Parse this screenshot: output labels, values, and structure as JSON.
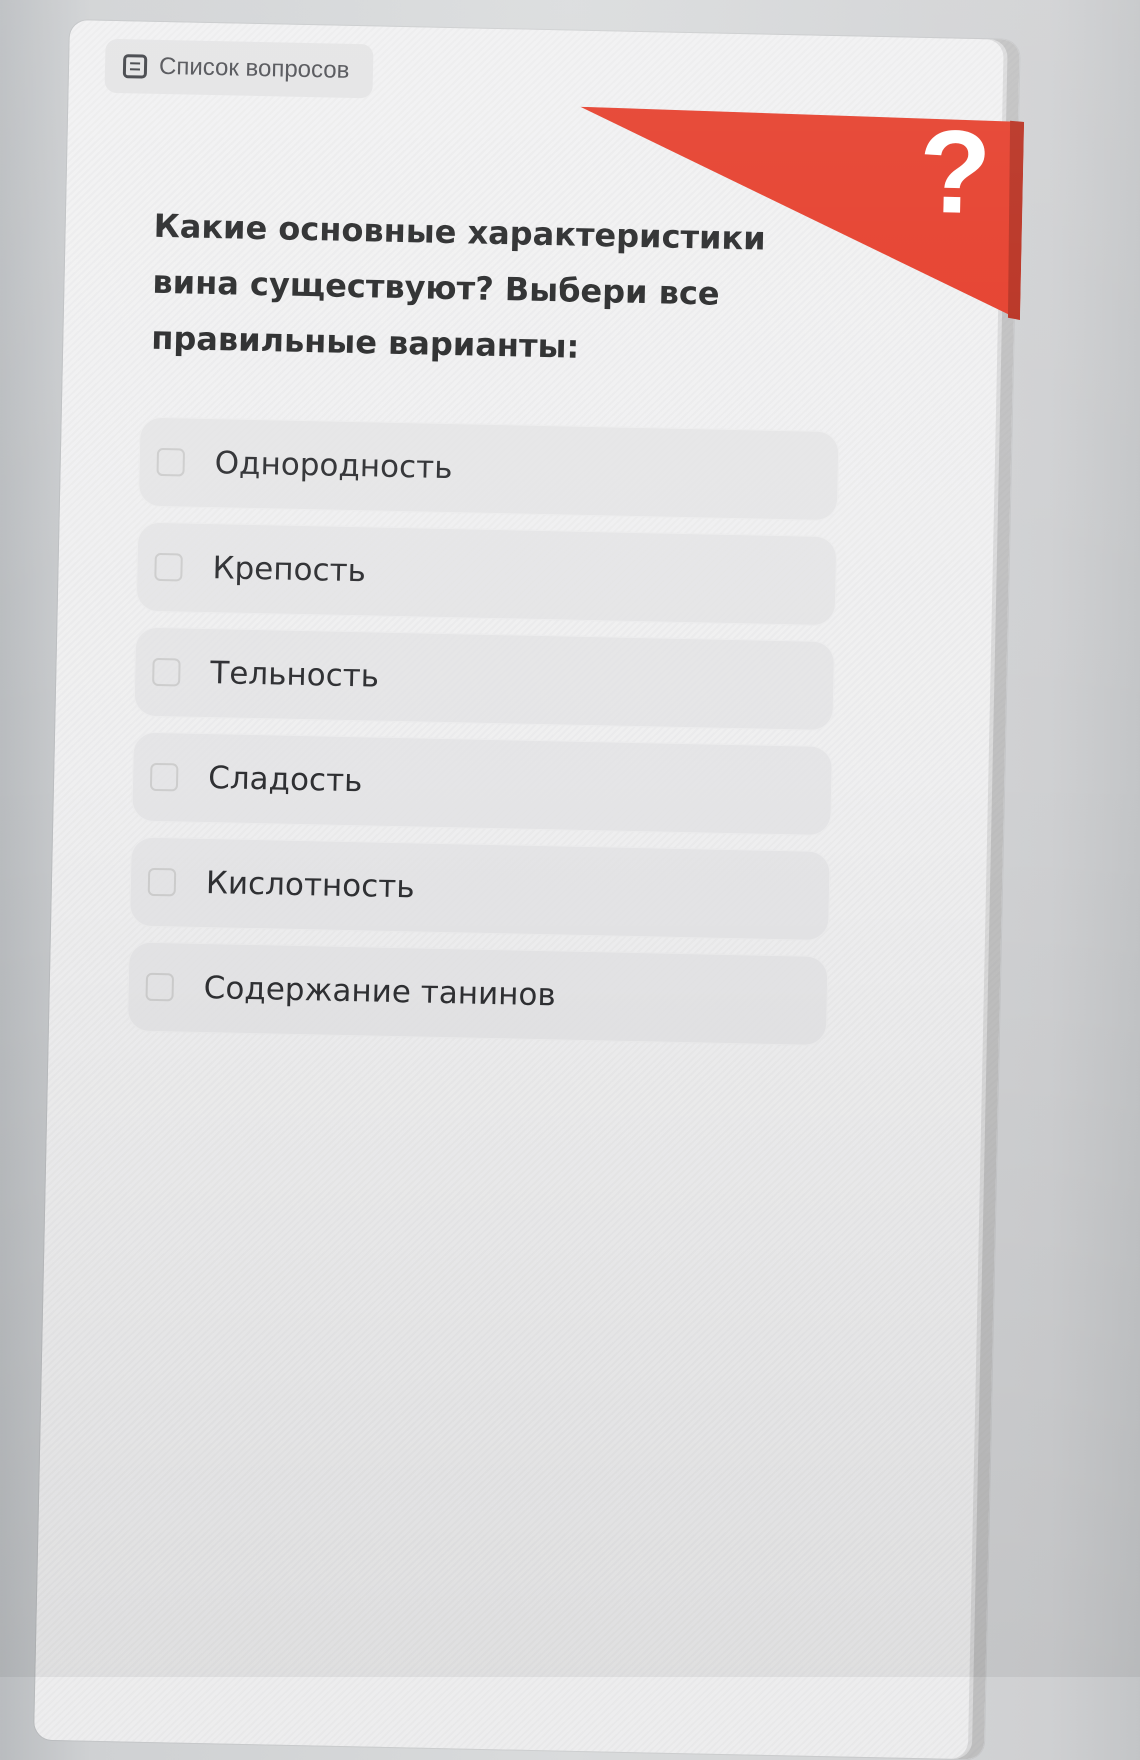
{
  "tab": {
    "label": "Список вопросов",
    "icon": "list-icon"
  },
  "question": {
    "text": "Какие основные характеристики вина существуют? Выбери все правильные варианты:"
  },
  "options": [
    {
      "label": "Однородность"
    },
    {
      "label": "Крепость"
    },
    {
      "label": "Тельность"
    },
    {
      "label": "Сладость"
    },
    {
      "label": "Кислотность"
    },
    {
      "label": "Содержание танинов"
    }
  ],
  "decoration": {
    "question_mark": "?",
    "accent_color": "#e53b28",
    "text_color": "#272829"
  }
}
